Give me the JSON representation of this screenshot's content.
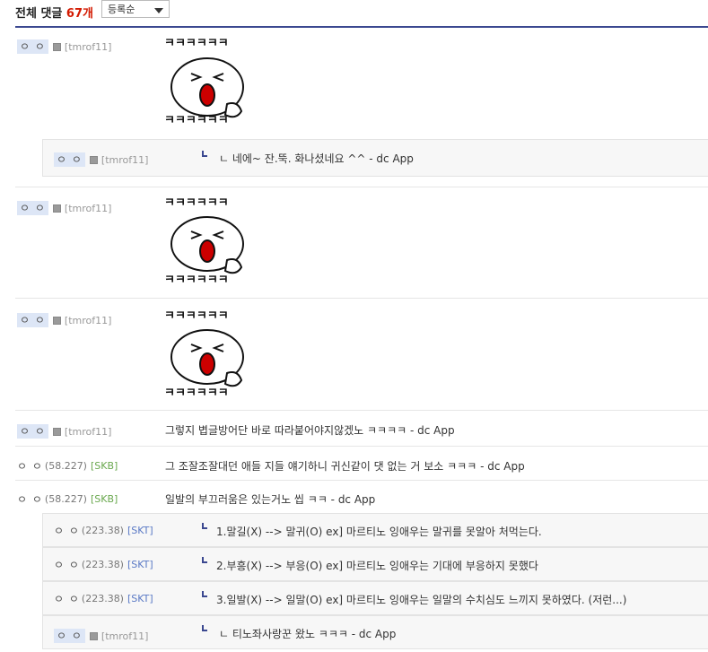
{
  "header": {
    "title_prefix": "전체 댓글",
    "count": "67개",
    "sort_label": "등록순"
  },
  "dccon_text": "ㅋㅋㅋㅋㅋㅋ",
  "comments": [
    {
      "dots": "ㅇ ㅇ",
      "user": "[tmrof11]",
      "content": ""
    },
    {
      "dots": "ㅇ ㅇ",
      "user": "[tmrof11]",
      "content": "ㄴ 네에~ 잔.뚝. 화나셨네요 ^^ - dc App"
    },
    {
      "dots": "ㅇ ㅇ",
      "user": "[tmrof11]",
      "content": ""
    },
    {
      "dots": "ㅇ ㅇ",
      "user": "[tmrof11]",
      "content": ""
    },
    {
      "dots": "ㅇ ㅇ",
      "user": "[tmrof11]",
      "content": "그렇지 볍글방어단 바로 따라붙어야지않겠노 ㅋㅋㅋㅋ - dc App"
    },
    {
      "dots": "ㅇ ㅇ",
      "ip": "(58.227)",
      "isp": "[SKB]",
      "content": "그 조잘조잘대던 애들 지들 얘기하니 귀신같이 댓 없는 거 보소 ㅋㅋㅋ - dc App"
    },
    {
      "dots": "ㅇ ㅇ",
      "ip": "(58.227)",
      "isp": "[SKB]",
      "content": "일발의 부끄러움은 있는거노 씹 ㅋㅋ - dc App"
    },
    {
      "dots": "ㅇ ㅇ",
      "ip": "(223.38)",
      "isp": "[SKT]",
      "content": "1.말길(X) --> 말귀(O) ex] 마르티노 잉애우는 말귀를 못알아 처먹는다."
    },
    {
      "dots": "ㅇ ㅇ",
      "ip": "(223.38)",
      "isp": "[SKT]",
      "content": "2.부흥(X) --> 부응(O) ex] 마르티노 잉애우는 기대에 부응하지 못했다"
    },
    {
      "dots": "ㅇ ㅇ",
      "ip": "(223.38)",
      "isp": "[SKT]",
      "content": "3.일발(X) --> 일말(O) ex] 마르티노 잉애우는 일말의 수치심도 느끼지 못하였다. (저런...)"
    },
    {
      "dots": "ㅇ ㅇ",
      "user": "[tmrof11]",
      "content": "ㄴ 티노좌사랑꾼 왔노 ㅋㅋㅋ - dc App"
    }
  ]
}
